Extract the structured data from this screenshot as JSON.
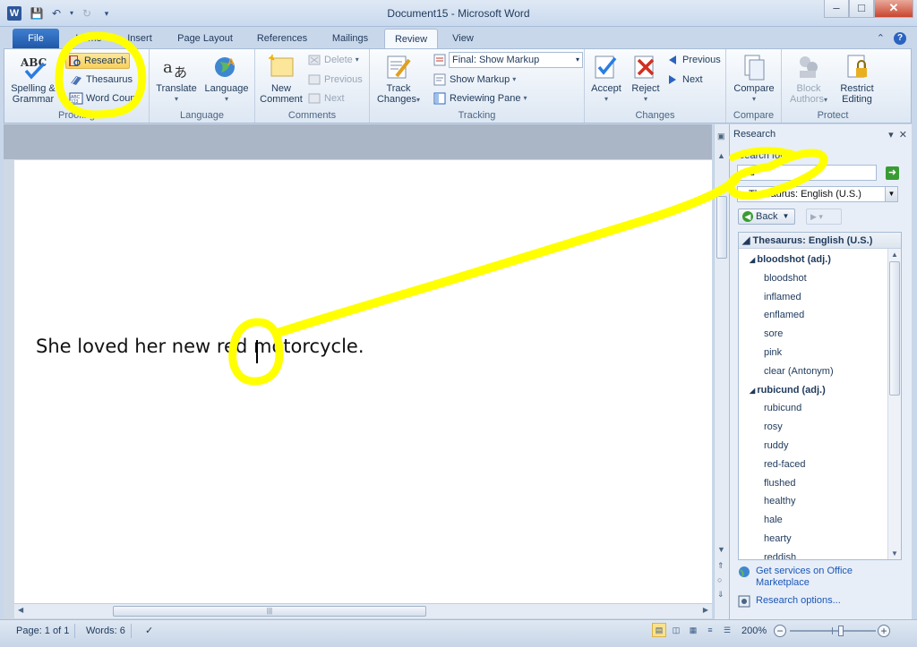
{
  "window": {
    "title": "Document15  -  Microsoft Word",
    "app_icon": "W",
    "controls": [
      "minimize-icon",
      "maximize-icon",
      "close-icon"
    ]
  },
  "tabs": [
    "File",
    "Home",
    "Insert",
    "Page Layout",
    "References",
    "Mailings",
    "Review",
    "View"
  ],
  "active_tab": "Review",
  "ribbon": {
    "proofing": {
      "label": "Proofing",
      "spelling": "Spelling &",
      "spelling2": "Grammar",
      "research": "Research",
      "thesaurus": "Thesaurus",
      "word_count": "Word Count"
    },
    "language": {
      "label": "Language",
      "translate": "Translate",
      "language": "Language"
    },
    "comments": {
      "label": "Comments",
      "new_comment": "New",
      "new_comment2": "Comment",
      "delete": "Delete",
      "previous": "Previous",
      "next": "Next"
    },
    "tracking": {
      "label": "Tracking",
      "track_changes": "Track",
      "track_changes2": "Changes",
      "display_for_review": "Final: Show Markup",
      "show_markup": "Show Markup",
      "reviewing_pane": "Reviewing Pane"
    },
    "changes": {
      "label": "Changes",
      "accept": "Accept",
      "reject": "Reject",
      "previous": "Previous",
      "next": "Next"
    },
    "compare": {
      "label": "Compare",
      "compare": "Compare"
    },
    "protect": {
      "label": "Protect",
      "block_authors": "Block",
      "block_authors2": "Authors",
      "restrict_editing": "Restrict",
      "restrict_editing2": "Editing"
    }
  },
  "document": {
    "text_before": "She loved her new re",
    "text_after": "d motorcycle."
  },
  "research_pane": {
    "title": "Research",
    "search_label": "Search for:",
    "search_value": "red",
    "reference_book": "Thesaurus: English (U.S.)",
    "back_label": "Back",
    "results_header": "Thesaurus: English (U.S.)",
    "results": [
      {
        "text": "bloodshot (adj.)",
        "heading": true
      },
      {
        "text": "bloodshot",
        "heading": false
      },
      {
        "text": "inflamed",
        "heading": false
      },
      {
        "text": "enflamed",
        "heading": false
      },
      {
        "text": "sore",
        "heading": false
      },
      {
        "text": "pink",
        "heading": false
      },
      {
        "text": "clear (Antonym)",
        "heading": false
      },
      {
        "text": "rubicund (adj.)",
        "heading": true
      },
      {
        "text": "rubicund",
        "heading": false
      },
      {
        "text": "rosy",
        "heading": false
      },
      {
        "text": "ruddy",
        "heading": false
      },
      {
        "text": "red-faced",
        "heading": false
      },
      {
        "text": "flushed",
        "heading": false
      },
      {
        "text": "healthy",
        "heading": false
      },
      {
        "text": "hale",
        "heading": false
      },
      {
        "text": "hearty",
        "heading": false
      },
      {
        "text": "reddish",
        "heading": false
      }
    ],
    "office_marketplace": "Get services on Office",
    "office_marketplace2": "Marketplace",
    "research_options": "Research options..."
  },
  "status_bar": {
    "page": "Page: 1 of 1",
    "words": "Words: 6",
    "zoom": "200%",
    "zoom_level_fraction": 0.5
  },
  "colors": {
    "annotation": "#ffff00",
    "ribbon_highlight": "#fbe28a",
    "file_tab": "#2b63c0"
  }
}
